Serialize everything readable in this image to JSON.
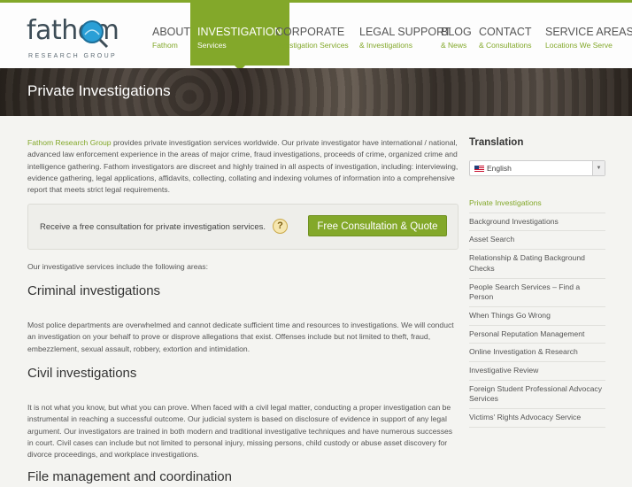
{
  "brand": {
    "name": "fathom",
    "tagline": "RESEARCH GROUP"
  },
  "nav": [
    {
      "label": "ABOUT",
      "sub": "Fathom"
    },
    {
      "label": "INVESTIGATION",
      "sub": "Services",
      "active": true
    },
    {
      "label": "CORPORATE",
      "sub": "Investigation Services"
    },
    {
      "label": "LEGAL SUPPORT",
      "sub": "& Investigations"
    },
    {
      "label": "BLOG",
      "sub": "& News"
    },
    {
      "label": "CONTACT",
      "sub": "& Consultations"
    },
    {
      "label": "SERVICE AREAS",
      "sub": "Locations We Serve"
    }
  ],
  "banner": {
    "title": "Private Investigations"
  },
  "intro": {
    "link": "Fathom Research Group",
    "text": " provides private investigation services worldwide. Our private investigator have international / national, advanced law enforcement experience in the areas of major crime, fraud investigations, proceeds of crime, organized crime and intelligence gathering. Fathom investigators are discreet and highly trained in all aspects of investigation, including: interviewing, evidence gathering, legal applications, affidavits, collecting, collating and indexing volumes of information into a comprehensive report that meets strict legal requirements."
  },
  "cta": {
    "text": "Receive a free consultation for private investigation services.",
    "help": "?",
    "button": "Free Consultation & Quote"
  },
  "services_intro": "Our investigative services include the following areas:",
  "sections": [
    {
      "heading": "Criminal investigations",
      "body": "Most police departments are overwhelmed and cannot dedicate sufficient time and resources to investigations. We will conduct an investigation on your behalf to prove or disprove allegations that exist. Offenses include but not limited to theft, fraud, embezzlement, sexual assault, robbery, extortion and intimidation."
    },
    {
      "heading": "Civil investigations",
      "body": "It is not what you know, but what you can prove. When faced with a civil legal matter, conducting a proper investigation can be instrumental in reaching a successful outcome. Our judicial system is based on disclosure of evidence in support of any legal argument. Our investigators are trained in both modern and traditional investigative techniques and have numerous successes in court. Civil cases can include but not limited to personal injury, missing persons, child custody or abuse asset discovery for divorce proceedings, and workplace investigations."
    },
    {
      "heading": "File management and coordination",
      "body": ""
    }
  ],
  "sidebar": {
    "title": "Translation",
    "language": "English",
    "items": [
      "Private Investigations",
      "Background Investigations",
      "Asset Search",
      "Relationship & Dating Background Checks",
      "People Search Services – Find a Person",
      "When Things Go Wrong",
      "Personal Reputation Management",
      "Online Investigation & Research",
      "Investigative Review",
      "Foreign Student Professional Advocacy Services",
      "Victims' Rights Advocacy Service"
    ]
  },
  "colors": {
    "accent": "#83a82a",
    "text": "#555555",
    "background": "#f4f4f1"
  }
}
